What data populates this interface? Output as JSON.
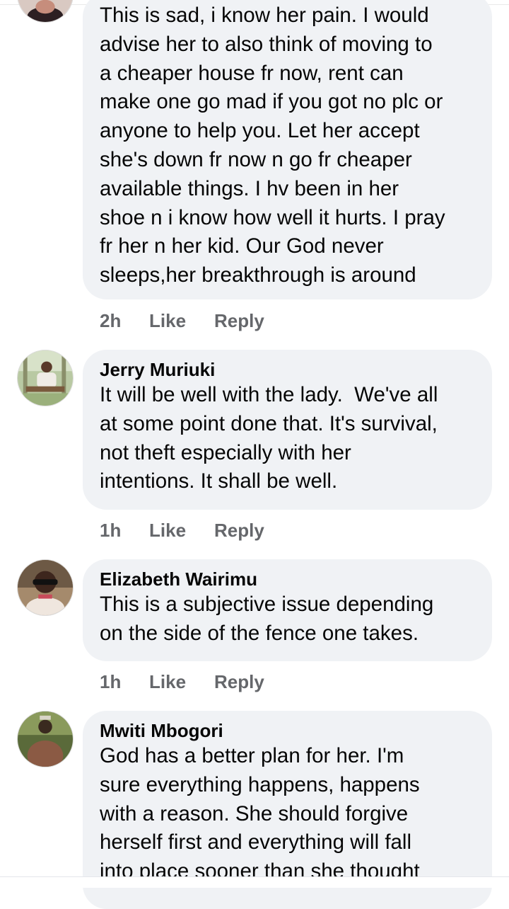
{
  "comments": [
    {
      "author": "",
      "text": "This is sad, i know her pain. I would\nadvise her to also think of moving to\na cheaper house fr now, rent can\nmake one go mad if you got no plc or\nanyone to help you. Let her accept\nshe's down fr now n go fr cheaper\navailable things. I hv been in her\nshoe n i know how well it hurts. I pray\nfr her n her kid. Our God never\nsleeps,her breakthrough is around",
      "time": "2h",
      "like": "Like",
      "reply": "Reply"
    },
    {
      "author": "Jerry Muriuki",
      "text": "It will be well with the lady.  We've all\nat some point done that. It's survival,\nnot theft especially with her\nintentions. It shall be well.",
      "time": "1h",
      "like": "Like",
      "reply": "Reply"
    },
    {
      "author": "Elizabeth Wairimu",
      "text": "This is a subjective issue depending\non the side of the fence one takes.",
      "time": "1h",
      "like": "Like",
      "reply": "Reply"
    },
    {
      "author": "Mwiti Mbogori",
      "text": "God has a better plan for her. I'm\nsure everything happens, happens\nwith a reason. She should forgive\nherself first and everything will fall\ninto place sooner than she thought",
      "time": "",
      "like": "",
      "reply": ""
    }
  ],
  "colors": {
    "bubble": "#f0f2f5",
    "text": "#050505",
    "meta": "#65676b"
  },
  "icons": {
    "avatar": "profile-photo"
  }
}
